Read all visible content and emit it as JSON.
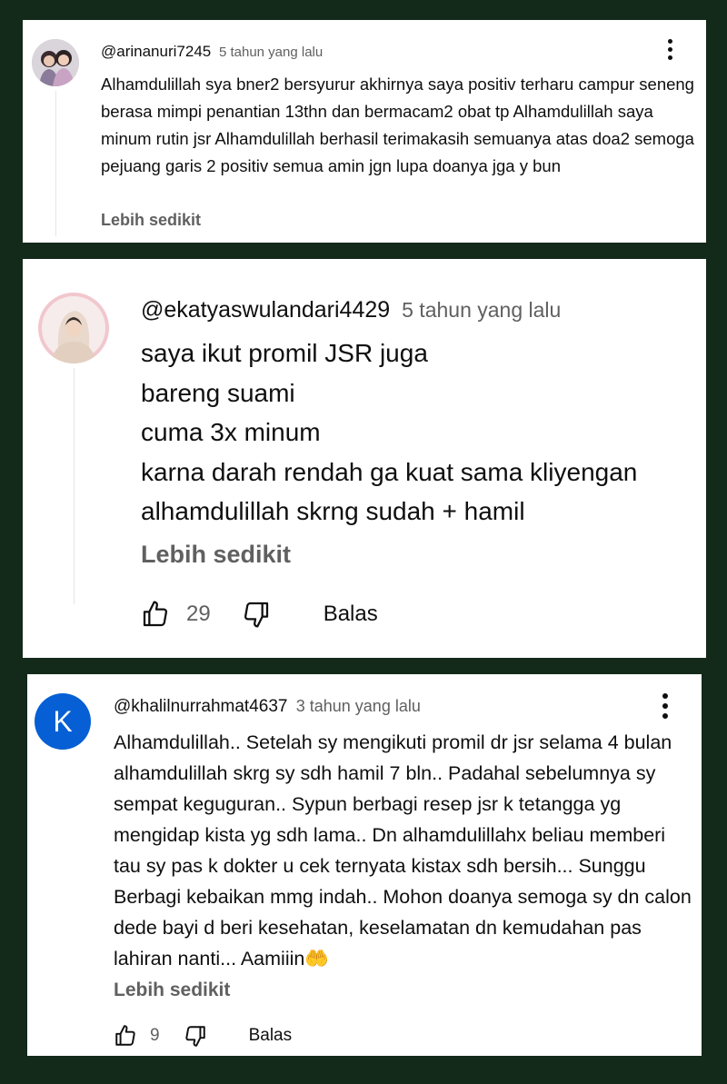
{
  "comments": [
    {
      "handle": "@arinanuri7245",
      "time": "5 tahun yang lalu",
      "text": "Alhamdulillah sya bner2 bersyurur akhirnya saya positiv terharu campur seneng berasa mimpi penantian 13thn dan bermacam2 obat tp Alhamdulillah saya minum rutin jsr Alhamdulillah berhasil terimakasih semuanya atas doa2 semoga pejuang garis 2 positiv semua amin jgn lupa doanya jga y bun",
      "show_less": "Lebih sedikit",
      "menu_icon": "more-vert-icon"
    },
    {
      "handle": "@ekatyaswulandari4429",
      "time": "5 tahun yang lalu",
      "lines": [
        "saya ikut promil JSR juga",
        "bareng suami",
        "cuma 3x minum",
        "karna darah rendah ga kuat sama kliyengan",
        "alhamdulillah skrng sudah + hamil"
      ],
      "show_less": "Lebih sedikit",
      "likes": "29",
      "reply": "Balas"
    },
    {
      "handle": "@khalilnurrahmat4637",
      "time": "3 tahun yang lalu",
      "avatar_letter": "K",
      "text": "Alhamdulillah.. Setelah sy mengikuti promil dr jsr selama 4 bulan alhamdulillah skrg sy sdh hamil 7 bln.. Padahal sebelumnya sy sempat keguguran.. Sypun berbagi resep jsr k tetangga yg mengidap kista yg sdh lama.. Dn alhamdulillahx beliau memberi tau sy pas k dokter u cek ternyata kistax sdh bersih... Sunggu Berbagi kebaikan mmg indah.. Mohon doanya semoga sy dn calon dede bayi d beri kesehatan, keselamatan dn kemudahan pas lahiran nanti... Aamiiin",
      "emoji": "🤲",
      "show_less": "Lebih sedikit",
      "likes": "9",
      "reply": "Balas",
      "menu_icon": "more-vert-icon"
    }
  ],
  "colors": {
    "background": "#13291a",
    "card": "#ffffff",
    "text": "#0f0f0f",
    "secondary_text": "#606060",
    "avatar_k": "#065fd4",
    "emoji": "#f5c518"
  }
}
